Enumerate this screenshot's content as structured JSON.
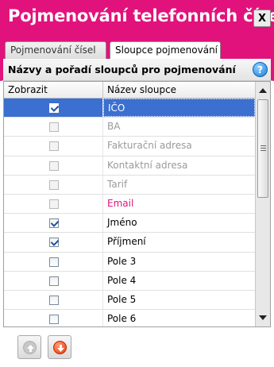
{
  "window": {
    "title": "Pojmenování telefonních čísel",
    "close_label": "X"
  },
  "tabs": [
    {
      "label": "Pojmenování čísel",
      "active": false
    },
    {
      "label": "Sloupce pojmenování",
      "active": true
    }
  ],
  "section": {
    "title": "Názvy a pořadí sloupců pro pojmenování",
    "help_icon": "help-icon"
  },
  "grid": {
    "columns": [
      "Zobrazit",
      "Název sloupce"
    ],
    "rows": [
      {
        "name": "IČO",
        "checked": true,
        "enabled": true,
        "selected": true,
        "color": "normal"
      },
      {
        "name": "BA",
        "checked": false,
        "enabled": false,
        "selected": false,
        "color": "disabled"
      },
      {
        "name": "Fakturační adresa",
        "checked": false,
        "enabled": false,
        "selected": false,
        "color": "disabled"
      },
      {
        "name": "Kontaktní adresa",
        "checked": false,
        "enabled": false,
        "selected": false,
        "color": "disabled"
      },
      {
        "name": "Tarif",
        "checked": false,
        "enabled": false,
        "selected": false,
        "color": "disabled"
      },
      {
        "name": "Email",
        "checked": false,
        "enabled": false,
        "selected": false,
        "color": "accent"
      },
      {
        "name": "Jméno",
        "checked": true,
        "enabled": true,
        "selected": false,
        "color": "normal"
      },
      {
        "name": "Příjmení",
        "checked": true,
        "enabled": true,
        "selected": false,
        "color": "normal"
      },
      {
        "name": "Pole 3",
        "checked": false,
        "enabled": true,
        "selected": false,
        "color": "normal"
      },
      {
        "name": "Pole 4",
        "checked": false,
        "enabled": true,
        "selected": false,
        "color": "normal"
      },
      {
        "name": "Pole 5",
        "checked": false,
        "enabled": true,
        "selected": false,
        "color": "normal"
      },
      {
        "name": "Pole 6",
        "checked": false,
        "enabled": true,
        "selected": false,
        "color": "normal"
      }
    ]
  },
  "footer": {
    "move_up_icon": "arrow-up-icon",
    "move_up_enabled": false,
    "move_down_icon": "arrow-down-icon",
    "move_down_enabled": true
  },
  "colors": {
    "brand": "#e2127c",
    "selection": "#3b6fd0",
    "disabled_text": "#9a9a9a"
  }
}
